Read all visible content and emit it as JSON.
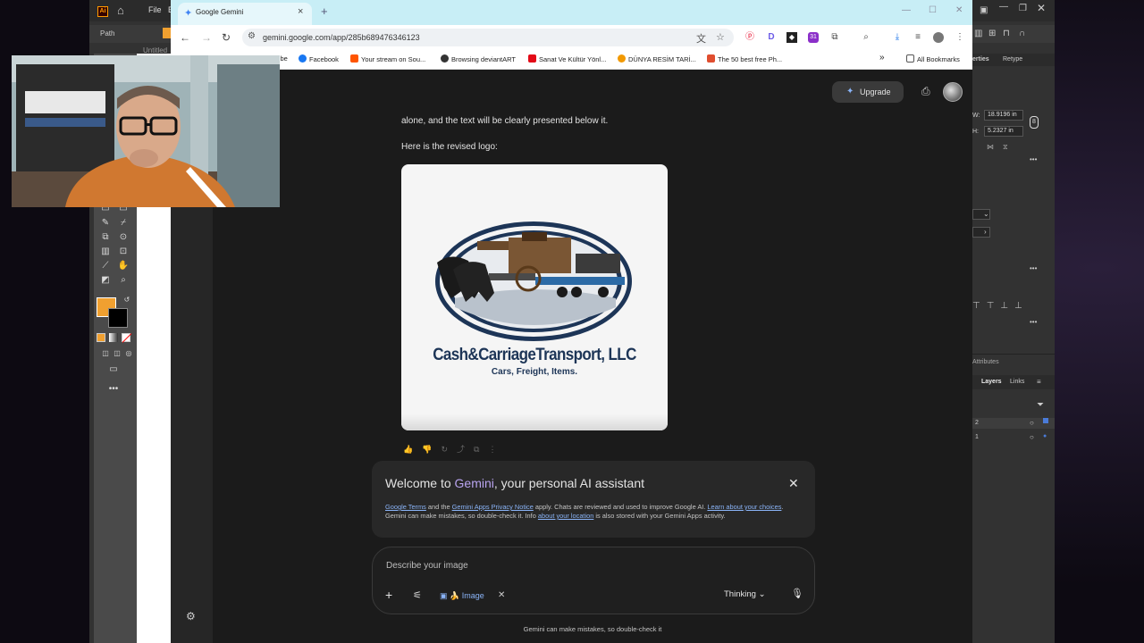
{
  "illustrator": {
    "menu_file": "File",
    "menu_edit": "E",
    "path_label": "Path",
    "doc_tab": "Untitled",
    "panels": {
      "properties_tab": "erties",
      "retype_tab": "Retype",
      "w_label": "W:",
      "w_value": "18.9196 in",
      "h_label": "H:",
      "h_value": "5.2327 in",
      "attributes": "Attributes",
      "layers_tab": "Layers",
      "links_tab": "Links",
      "layer_2": "2",
      "layer_1": "1"
    },
    "colors": {
      "fill": "#f0a030",
      "stroke": "#000000"
    }
  },
  "browser": {
    "tab_title": "Google Gemini",
    "url": "gemini.google.com/app/285b689476346123",
    "bookmarks": [
      {
        "label": "Tube",
        "color": "#ff0000"
      },
      {
        "label": "Facebook",
        "color": "#1877f2"
      },
      {
        "label": "Your stream on Sou...",
        "color": "#ff5500"
      },
      {
        "label": "Browsing deviantART",
        "color": "#333333"
      },
      {
        "label": "Sanat Ve Kültür Yönl...",
        "color": "#e30a17"
      },
      {
        "label": "DÜNYA RESİM TARİ...",
        "color": "#f29900"
      },
      {
        "label": "The 50 best free Ph...",
        "color": "#e04e2f"
      }
    ],
    "all_bookmarks": "All Bookmarks"
  },
  "gemini": {
    "upgrade_label": "Upgrade",
    "message_line1": "alone, and the text will be clearly presented below it.",
    "message_line2": "Here is the revised logo:",
    "logo": {
      "company": "Cash&CarriageTransport, LLC",
      "tagline": "Cars, Freight, Items."
    },
    "welcome": {
      "title_pre": "Welcome to ",
      "title_brand": "Gemini",
      "title_post": ", your personal AI assistant",
      "link_terms": "Google Terms",
      "text1": " and the ",
      "link_privacy": "Gemini Apps Privacy Notice",
      "text2": " apply. Chats are reviewed and used to improve Google AI. ",
      "link_learn": "Learn about your choices",
      "text3": ". Gemini can make mistakes, so double-check it. Info ",
      "link_location": "about your location",
      "text4": " is also stored with your Gemini Apps activity."
    },
    "input": {
      "placeholder": "Describe your image",
      "chip_label": "Image",
      "chip_emoji": "🍌",
      "mode_label": "Thinking"
    },
    "footer": "Gemini can make mistakes, so double-check it"
  }
}
